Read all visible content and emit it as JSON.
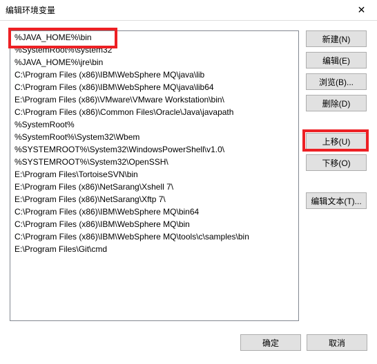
{
  "window": {
    "title": "编辑环境变量",
    "close": "✕"
  },
  "list": {
    "items": [
      "%JAVA_HOME%\\bin",
      "%SystemRoot%\\system32",
      "%JAVA_HOME%\\jre\\bin",
      "C:\\Program Files (x86)\\IBM\\WebSphere MQ\\java\\lib",
      "C:\\Program Files (x86)\\IBM\\WebSphere MQ\\java\\lib64",
      "E:\\Program Files (x86)\\VMware\\VMware Workstation\\bin\\",
      "C:\\Program Files (x86)\\Common Files\\Oracle\\Java\\javapath",
      "%SystemRoot%",
      "%SystemRoot%\\System32\\Wbem",
      "%SYSTEMROOT%\\System32\\WindowsPowerShell\\v1.0\\",
      "%SYSTEMROOT%\\System32\\OpenSSH\\",
      "E:\\Program Files\\TortoiseSVN\\bin",
      "E:\\Program Files (x86)\\NetSarang\\Xshell 7\\",
      "E:\\Program Files (x86)\\NetSarang\\Xftp 7\\",
      "C:\\Program Files (x86)\\IBM\\WebSphere MQ\\bin64",
      "C:\\Program Files (x86)\\IBM\\WebSphere MQ\\bin",
      "C:\\Program Files (x86)\\IBM\\WebSphere MQ\\tools\\c\\samples\\bin",
      "E:\\Program Files\\Git\\cmd"
    ]
  },
  "buttons": {
    "new": "新建(N)",
    "edit": "编辑(E)",
    "browse": "浏览(B)...",
    "delete": "删除(D)",
    "moveup": "上移(U)",
    "movedown": "下移(O)",
    "edittext": "编辑文本(T)...",
    "ok": "确定",
    "cancel": "取消"
  },
  "highlights": {
    "first_item": true,
    "moveup_button": true
  }
}
